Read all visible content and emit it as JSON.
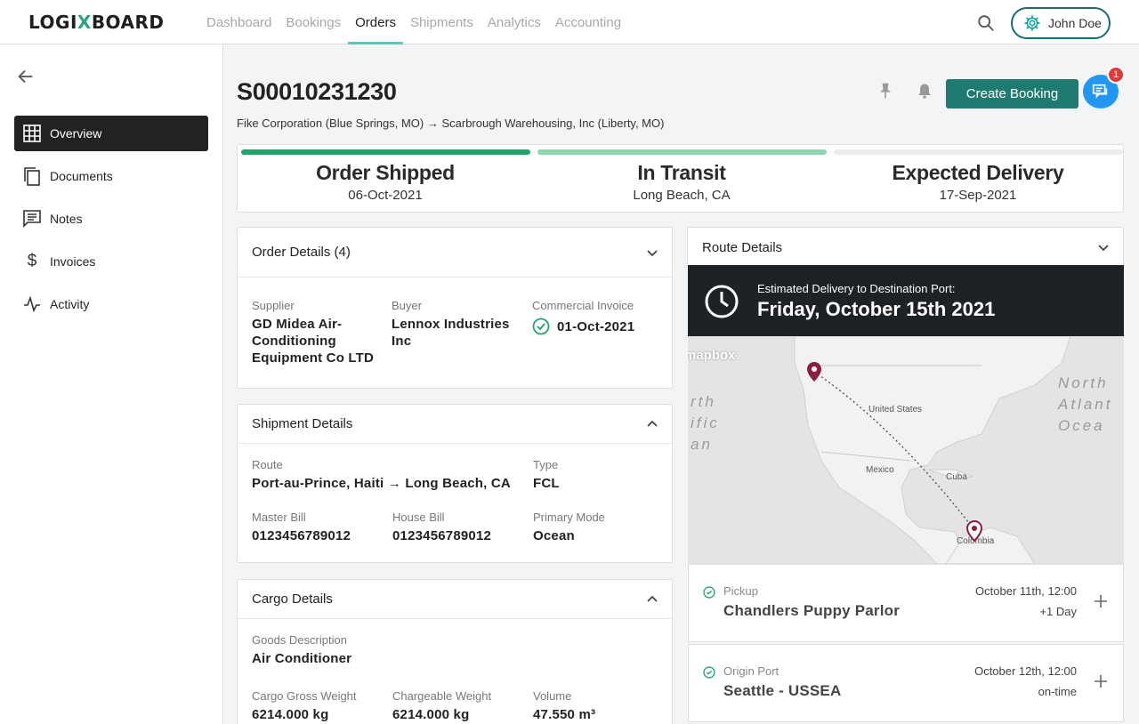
{
  "brand": {
    "logo_pre": "LOGI",
    "logo_x": "X",
    "logo_post": "BOARD",
    "accent": "#28a77a"
  },
  "nav": {
    "items": [
      {
        "label": "Dashboard",
        "active": false
      },
      {
        "label": "Bookings",
        "active": false
      },
      {
        "label": "Orders",
        "active": true
      },
      {
        "label": "Shipments",
        "active": false
      },
      {
        "label": "Analytics",
        "active": false
      },
      {
        "label": "Accounting",
        "active": false
      }
    ],
    "user_name": "John Doe"
  },
  "sidebar": {
    "items": [
      {
        "label": "Overview",
        "icon": "grid-icon",
        "active": true
      },
      {
        "label": "Documents",
        "icon": "documents-icon",
        "active": false
      },
      {
        "label": "Notes",
        "icon": "notes-icon",
        "active": false
      },
      {
        "label": "Invoices",
        "icon": "dollar-icon",
        "active": false
      },
      {
        "label": "Activity",
        "icon": "activity-icon",
        "active": false
      }
    ]
  },
  "order": {
    "id": "S00010231230",
    "route_summary": "Fike Corporation (Blue Springs, MO) → Scarbrough Warehousing, Inc (Liberty, MO)",
    "create_booking_label": "Create Booking",
    "chat_badge_count": "1"
  },
  "status": [
    {
      "label": "Order Shipped",
      "value": "06-Oct-2021",
      "bar_color": "#21a36b"
    },
    {
      "label": "In Transit",
      "value": "Long Beach, CA",
      "bar_color": "#8fd4b3"
    },
    {
      "label": "Expected Delivery",
      "value": "17-Sep-2021",
      "bar_color": "#ececec"
    }
  ],
  "order_details": {
    "title": "Order Details (4)",
    "supplier_k": "Supplier",
    "supplier_v": "GD Midea Air-Conditioning Equipment Co LTD",
    "buyer_k": "Buyer",
    "buyer_v": "Lennox Industries Inc",
    "invoice_k": "Commercial Invoice",
    "invoice_v": "01-Oct-2021"
  },
  "shipment_details": {
    "title": "Shipment Details",
    "route_k": "Route",
    "route_v": "Port-au-Prince, Haiti → Long Beach, CA",
    "type_k": "Type",
    "type_v": "FCL",
    "master_k": "Master Bill",
    "master_v": "0123456789012",
    "house_k": "House Bill",
    "house_v": "0123456789012",
    "mode_k": "Primary Mode",
    "mode_v": "Ocean"
  },
  "cargo_details": {
    "title": "Cargo Details",
    "goods_k": "Goods Description",
    "goods_v": "Air Conditioner",
    "gross_k": "Cargo Gross Weight",
    "gross_v": "6214.000 kg",
    "charge_k": "Chargeable Weight",
    "charge_v": "6214.000 kg",
    "volume_k": "Volume",
    "volume_v": "47.550 m³"
  },
  "route_details": {
    "title": "Route Details",
    "eta_k": "Estimated Delivery to Destination Port:",
    "eta_v": "Friday, October 15th 2021",
    "map": {
      "attribution": "mapbox",
      "labels": [
        "United States",
        "Mexico",
        "Cuba",
        "Colombia"
      ],
      "ocean_left": [
        "rth",
        "ific",
        "an"
      ],
      "ocean_right": [
        "North",
        "Atlant",
        "Ocea"
      ]
    },
    "stops": [
      {
        "type": "Pickup",
        "name": "Chandlers Puppy Parlor",
        "time": "October 11th, 12:00",
        "delta": "+1 Day"
      },
      {
        "type": "Origin Port",
        "name": "Seattle - USSEA",
        "time": "October 12th, 12:00",
        "delta": "on-time"
      }
    ]
  }
}
